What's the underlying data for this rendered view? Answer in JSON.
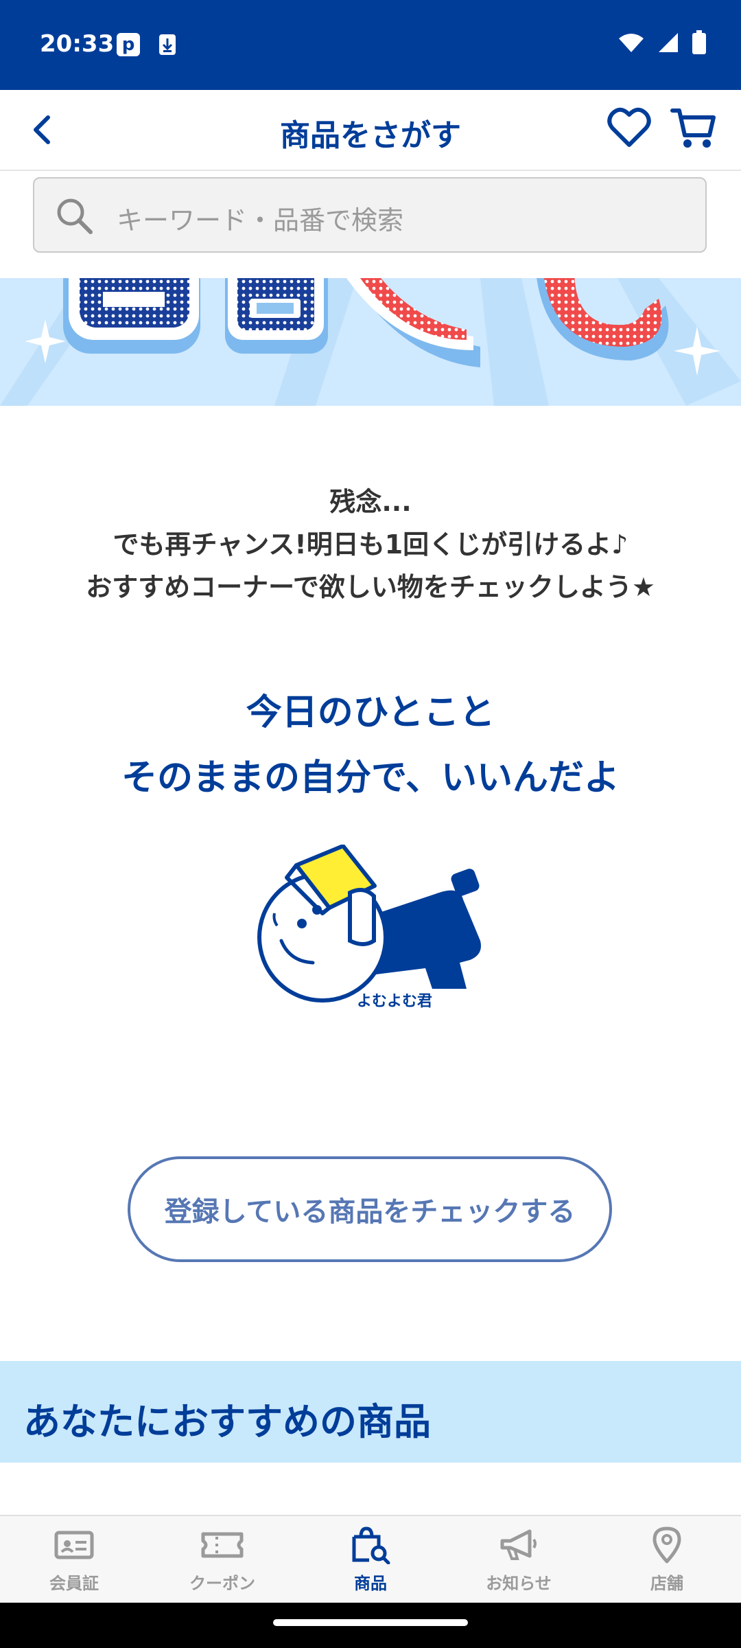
{
  "status_bar": {
    "time": "20:33",
    "icon1": "parking-icon",
    "icon2": "download-icon"
  },
  "app_bar": {
    "title": "商品をさがす"
  },
  "search": {
    "placeholder": "キーワード・品番で検索"
  },
  "message": {
    "line1": "残念...",
    "line2": "でも再チャンス!明日も1回くじが引けるよ♪",
    "line3": "おすすめコーナーで欲しい物をチェックしよう★"
  },
  "hitokoto": {
    "heading": "今日のひとこと",
    "text": "そのままの自分で、いいんだよ",
    "mascot_name": "よむよむ君"
  },
  "check_button": {
    "label": "登録している商品をチェックする"
  },
  "recommend": {
    "title": "あなたにおすすめの商品"
  },
  "bottom_nav": [
    {
      "label": "会員証",
      "icon": "member-card-icon",
      "active": false
    },
    {
      "label": "クーポン",
      "icon": "coupon-icon",
      "active": false
    },
    {
      "label": "商品",
      "icon": "shopping-bag-search-icon",
      "active": true
    },
    {
      "label": "お知らせ",
      "icon": "megaphone-icon",
      "active": false
    },
    {
      "label": "店舗",
      "icon": "location-pin-icon",
      "active": false
    }
  ],
  "colors": {
    "brand": "#003d99",
    "accent_light": "#c8e8fb",
    "button_outline": "#5677b4"
  }
}
